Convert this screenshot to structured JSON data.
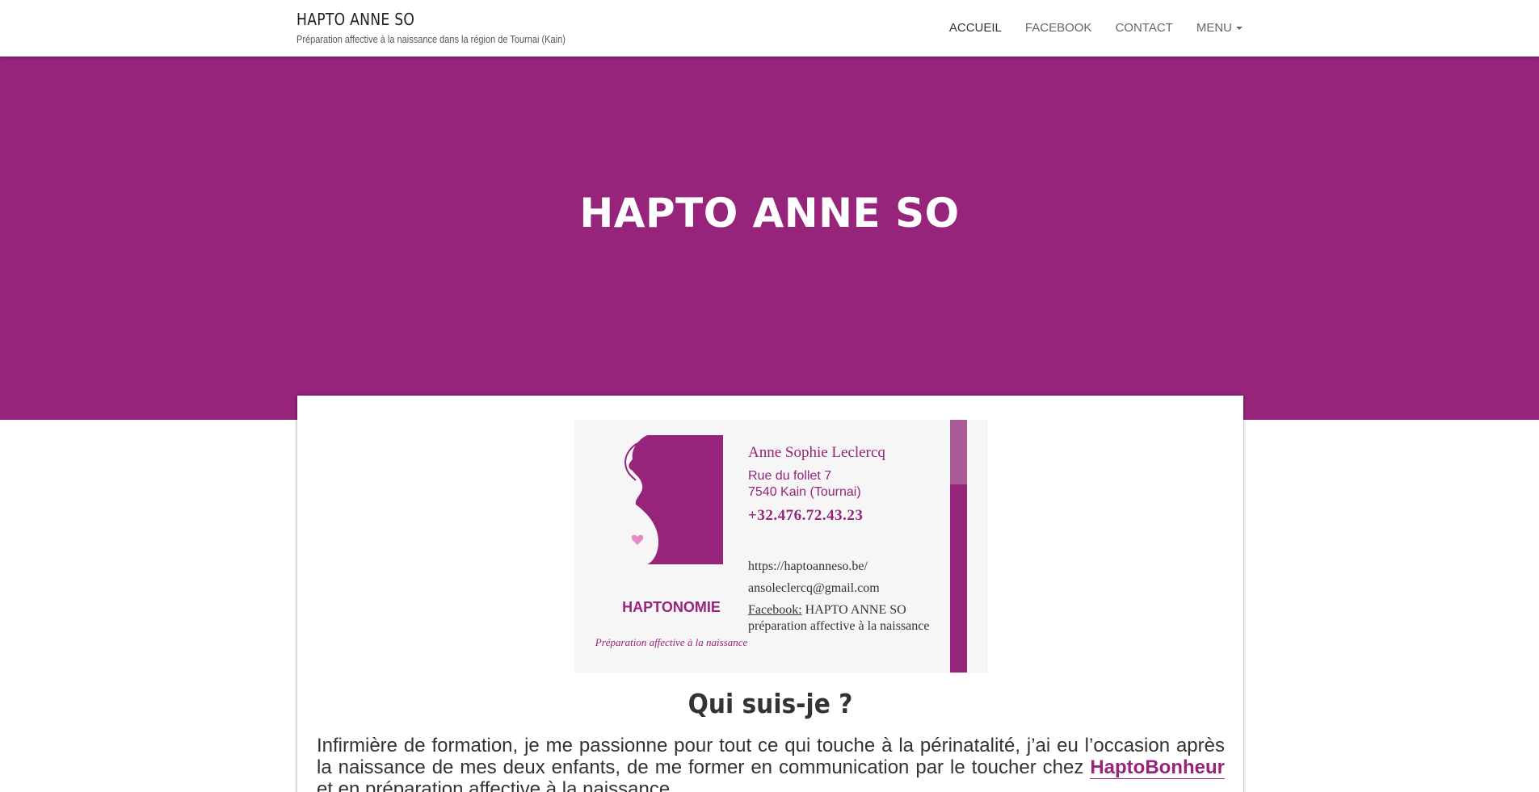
{
  "header": {
    "site_title": "HAPTO ANNE SO",
    "tagline": "Préparation affective à la naissance dans la région de Tournai (Kain)"
  },
  "nav": {
    "items": [
      {
        "label": "ACCUEIL"
      },
      {
        "label": "FACEBOOK"
      },
      {
        "label": "CONTACT"
      },
      {
        "label": "MENU"
      }
    ]
  },
  "hero": {
    "title": "HAPTO ANNE SO"
  },
  "card": {
    "logo_label": "HAPTONOMIE",
    "logo_subtitle": "Préparation affective à la naissance",
    "name": "Anne Sophie Leclercq",
    "address_line1": "Rue du follet 7",
    "address_line2": "7540 Kain (Tournai)",
    "phone": "+32.476.72.43.23",
    "website": "https://haptoanneso.be/",
    "email": "ansoleclercq@gmail.com",
    "facebook_label": "Facebook:",
    "facebook_value": "HAPTO ANNE SO préparation affective à la naissance"
  },
  "about": {
    "title": "Qui suis-je ?",
    "text_before_link": "Infirmière de formation, je me passionne pour tout ce qui touche à la périnatalité, j’ai eu l’occasion après la naissance de mes deux enfants, de me former en communication par le toucher chez ",
    "link_label": "HaptoBonheur",
    "text_after_link": " et en préparation affective à la naissance."
  },
  "colors": {
    "brand": "#96247a",
    "hero_background": "#96247a"
  }
}
